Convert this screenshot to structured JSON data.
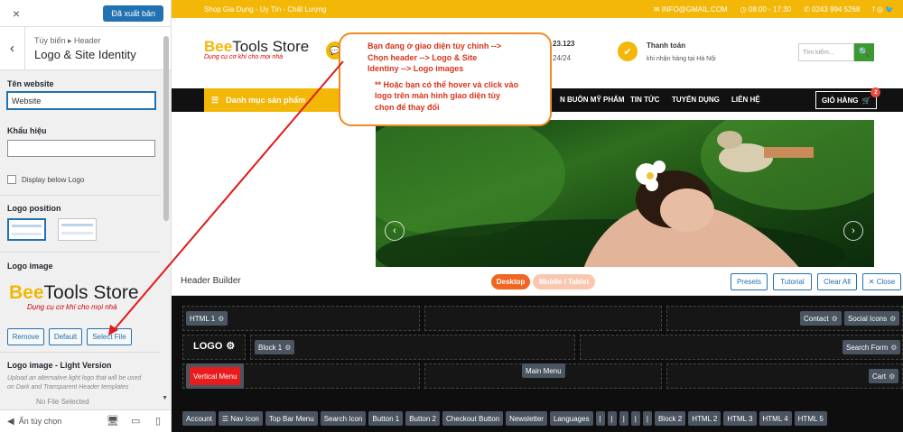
{
  "sidebar": {
    "close_icon": "×",
    "publish_label": "Đã xuất bản",
    "breadcrumb_small": "Tùy biến ▸ Header",
    "breadcrumb_title": "Logo & Site Identity",
    "site_name_label": "Tên website",
    "site_name_value": "Website",
    "tagline_label": "Khẩu hiệu",
    "tagline_value": "",
    "display_below_logo_label": "Display below Logo",
    "logo_position_label": "Logo position",
    "logo_image_label": "Logo image",
    "logo_image_brand_bee": "Bee",
    "logo_image_brand_tools": "Tools Store",
    "logo_image_brand_sub": "Dụng cụ cơ khí cho mọi nhà",
    "remove_label": "Remove",
    "default_label": "Default",
    "select_file_label": "Select File",
    "light_logo_label": "Logo image - Light Version",
    "light_logo_note": "Upload an alternative light logo that will be used on Dark and Transparent Header templates",
    "no_file_label": "No File Selected",
    "hide_controls_label": "Ẩn tùy chọn"
  },
  "topbar": {
    "slogan": "Shop Gia Dụng - Uy Tín - Chất Lượng",
    "email": "INFO@GMAIL.COM",
    "hours": "08:00 - 17:30",
    "phone": "0243 994 5268",
    "social": "f ◎ 🐦"
  },
  "header": {
    "brand_bee": "Bee",
    "brand_tools": "Tools Store",
    "brand_sub": "Dụng cụ cơ khí cho mọi nhà",
    "hotline_frag": "23.123",
    "support_frag": "24/24",
    "payment_title": "Thanh toán",
    "payment_sub": "khi nhận hàng tại Hà Nội",
    "search_placeholder": "Tìm kiếm...",
    "search_icon": "🔍"
  },
  "navbar": {
    "category_label": "Danh mục sản phẩm",
    "links": [
      "N BUÔN MỸ PHẨM",
      "TIN TỨC",
      "TUYỂN DỤNG",
      "LIÊN HỆ"
    ],
    "cart_label": "GIỎ HÀNG",
    "cart_count": "2"
  },
  "hero": {
    "prev": "‹",
    "next": "›"
  },
  "callout": {
    "line1": "Bạn đang ở giao diện tùy chỉnh -->",
    "line2": "Chọn header --> Logo & Site",
    "line3": "Identiny --> Logo images",
    "line4": "** Hoặc bạn có thể hover và click vào",
    "line5": "logo trên màn hình giao diện tùy",
    "line6": "chọn để thay đổi"
  },
  "builder": {
    "title": "Header Builder",
    "desktop": "Desktop",
    "mobile": "Mobile / Tablet",
    "presets": "Presets",
    "tutorial": "Tutorial",
    "clear_all": "Clear All",
    "close": "✕ Close",
    "html1": "HTML 1",
    "contact": "Contact",
    "social_icons": "Social Icons",
    "logo": "LOGO",
    "block1": "Block 1",
    "search_form": "Search Form",
    "vertical_menu": "Vertical Menu",
    "main_menu": "Main Menu",
    "cart": "Cart",
    "tray": [
      "Account",
      "☰ Nav Icon",
      "Top Bar Menu",
      "Search Icon",
      "Button 1",
      "Button 2",
      "Checkout Button",
      "Newsletter",
      "Languages",
      "|",
      "|",
      "|",
      "|",
      "|",
      "Block 2",
      "HTML 2",
      "HTML 3",
      "HTML 4",
      "HTML 5"
    ]
  },
  "colors": {
    "accent": "#f2b707",
    "publish": "#2271b1",
    "callout_border": "#f08a24",
    "callout_text": "#d9331a",
    "builder_bg": "#0e0e0e"
  }
}
